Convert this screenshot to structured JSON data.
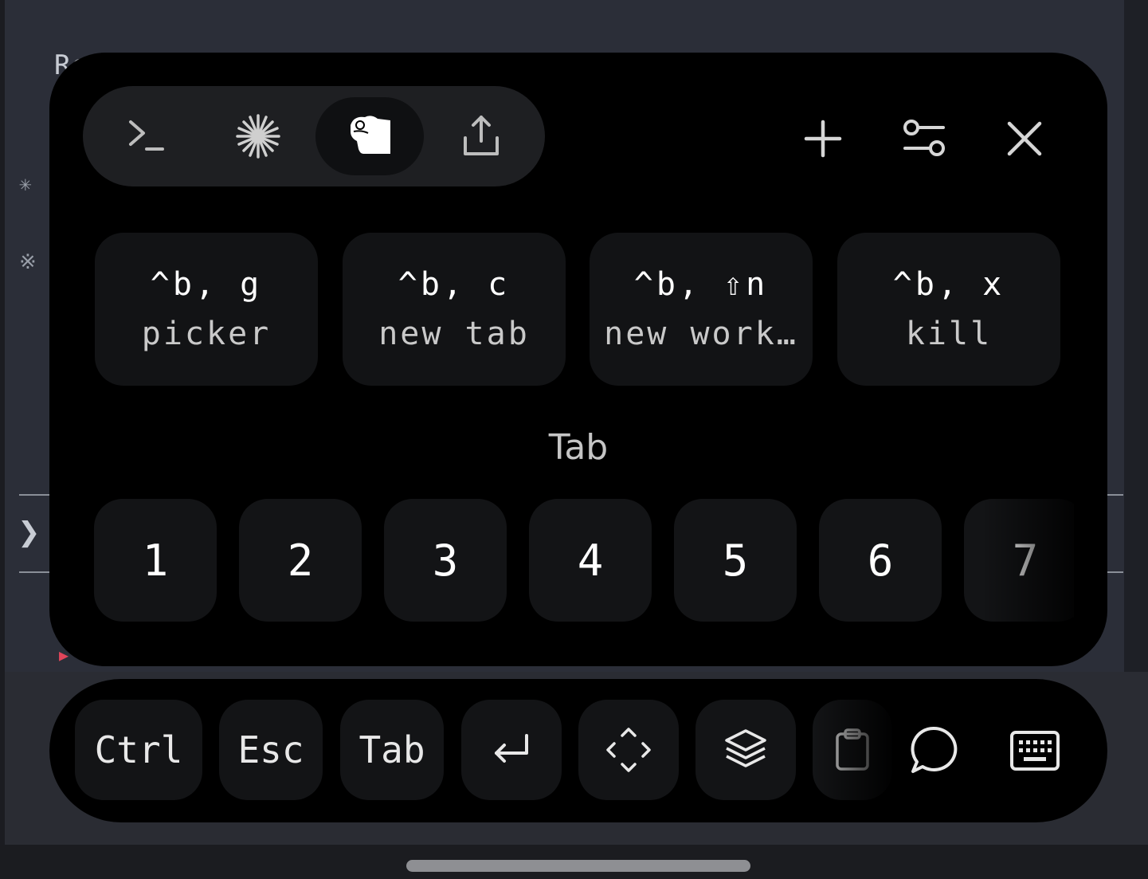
{
  "background_terminal": {
    "visible_text": "Rc",
    "side_glyphs": [
      "✳",
      "※"
    ],
    "chevron": "❯"
  },
  "panel": {
    "mode_tabs": [
      {
        "icon": "terminal-prompt-icon",
        "active": false
      },
      {
        "icon": "asterisk-burst-icon",
        "active": true,
        "note_active": false
      },
      {
        "icon": "mascot-icon",
        "active": true
      },
      {
        "icon": "share-upload-icon",
        "active": false
      }
    ],
    "actions": {
      "add_icon": "plus-icon",
      "settings_icon": "sliders-icon",
      "close_icon": "close-icon"
    },
    "shortcuts": [
      {
        "keys": "^b, g",
        "label": "picker"
      },
      {
        "keys": "^b, c",
        "label": "new tab"
      },
      {
        "keys": "^b, ⇧n",
        "label": "new work…"
      },
      {
        "keys": "^b, x",
        "label": "kill"
      }
    ],
    "section_title": "Tab",
    "tab_numbers": [
      "1",
      "2",
      "3",
      "4",
      "5",
      "6",
      "7"
    ]
  },
  "toolbar": {
    "ctrl": "Ctrl",
    "esc": "Esc",
    "tab": "Tab",
    "icons": [
      "return-icon",
      "move-arrows-icon",
      "layers-icon",
      "clipboard-icon",
      "chat-bubble-icon",
      "keyboard-icon"
    ]
  },
  "colors": {
    "panel_bg": "#000000",
    "card_bg": "#121315",
    "terminal_bg": "#2b2e38",
    "accent_red": "#e0455a"
  }
}
